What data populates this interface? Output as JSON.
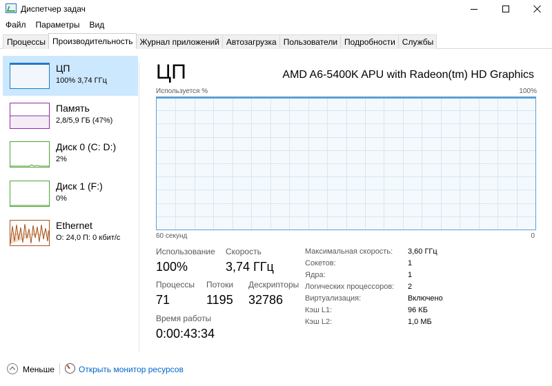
{
  "window": {
    "title": "Диспетчер задач"
  },
  "menu": [
    "Файл",
    "Параметры",
    "Вид"
  ],
  "tabs": [
    {
      "label": "Процессы"
    },
    {
      "label": "Производительность"
    },
    {
      "label": "Журнал приложений"
    },
    {
      "label": "Автозагрузка"
    },
    {
      "label": "Пользователи"
    },
    {
      "label": "Подробности"
    },
    {
      "label": "Службы"
    }
  ],
  "sidebar": {
    "items": [
      {
        "name": "ЦП",
        "sub": "100% 3,74 ГГц",
        "color": "#1f7ac8"
      },
      {
        "name": "Память",
        "sub": "2,8/5,9 ГБ (47%)",
        "color": "#8b2f9c"
      },
      {
        "name": "Диск 0 (C: D:)",
        "sub": "2%",
        "color": "#4da132"
      },
      {
        "name": "Диск 1 (F:)",
        "sub": "0%",
        "color": "#4da132"
      },
      {
        "name": "Ethernet",
        "sub": "О: 24,0 П: 0 кбит/с",
        "color": "#a6531a"
      }
    ]
  },
  "main": {
    "title": "ЦП",
    "cpu_model": "AMD A6-5400K APU with Radeon(tm) HD Graphics",
    "graph": {
      "label_left": "Используется %",
      "label_right": "100%",
      "axis_left": "60 секунд",
      "axis_right": "0",
      "border_color": "#5a9fd6"
    },
    "stats": {
      "usage_label": "Использование",
      "usage_value": "100%",
      "speed_label": "Скорость",
      "speed_value": "3,74 ГГц",
      "processes_label": "Процессы",
      "processes_value": "71",
      "threads_label": "Потоки",
      "threads_value": "1195",
      "handles_label": "Дескрипторы",
      "handles_value": "32786",
      "uptime_label": "Время работы",
      "uptime_value": "0:00:43:34"
    },
    "info": [
      {
        "label": "Максимальная скорость:",
        "value": "3,60 ГГц"
      },
      {
        "label": "Сокетов:",
        "value": "1"
      },
      {
        "label": "Ядра:",
        "value": "1"
      },
      {
        "label": "Логических процессоров:",
        "value": "2"
      },
      {
        "label": "Виртуализация:",
        "value": "Включено"
      },
      {
        "label": "Кэш L1:",
        "value": "96 КБ"
      },
      {
        "label": "Кэш L2:",
        "value": "1,0 МБ"
      }
    ]
  },
  "footer": {
    "less_label": "Меньше",
    "monitor_link": "Открыть монитор ресурсов"
  }
}
